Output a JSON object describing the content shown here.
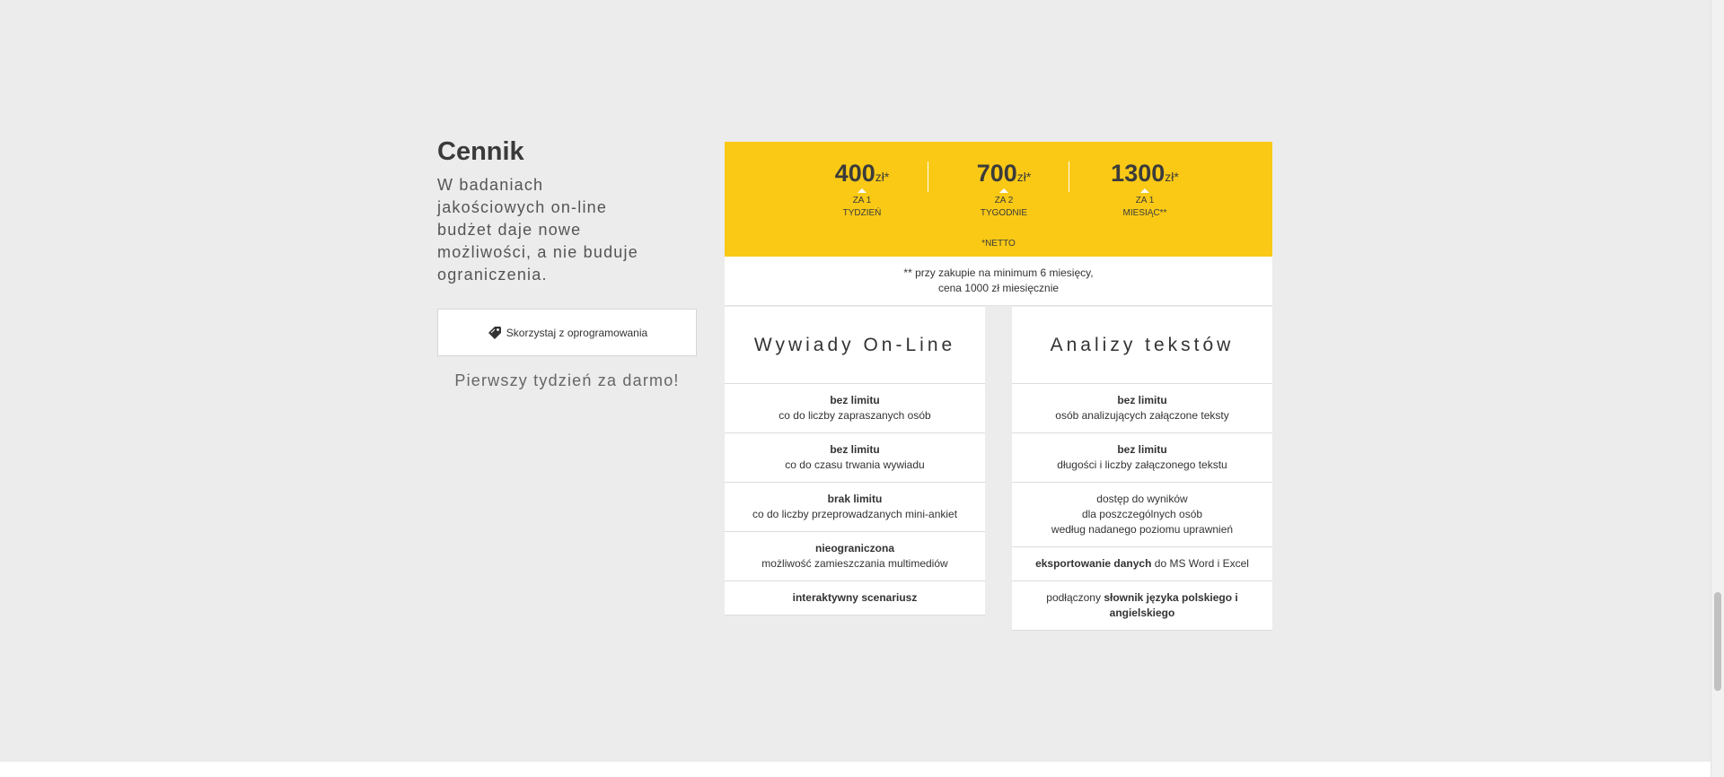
{
  "pricing": {
    "title": "Cennik",
    "description": "W badaniach jakościowych on-line budżet daje nowe możliwości, a nie buduje ograniczenia.",
    "cta_label": "Skorzystaj z oprogramowania",
    "cta_icon": "tag-icon",
    "free_trial": "Pierwszy tydzień za darmo!"
  },
  "prices": [
    {
      "amount": "400",
      "unit": "zł*",
      "period_line1": "ZA 1",
      "period_line2": "TYDZIEŃ"
    },
    {
      "amount": "700",
      "unit": "zł*",
      "period_line1": "ZA 2",
      "period_line2": "TYGODNIE"
    },
    {
      "amount": "1300",
      "unit": "zł*",
      "period_line1": "ZA 1",
      "period_line2": "MIESIĄC**"
    }
  ],
  "netto": "*NETTO",
  "note": {
    "line1": "** przy zakupie na minimum 6 miesięcy,",
    "line2": "cena 1000 zł miesięcznie"
  },
  "columns": [
    {
      "heading": "Wywiady On-Line",
      "rows": [
        {
          "bold": "bez limitu",
          "text": "co do liczby zapraszanych osób"
        },
        {
          "bold": "bez limitu",
          "text": "co do czasu trwania wywiadu"
        },
        {
          "bold": "brak limitu",
          "text": "co do liczby przeprowadzanych mini-ankiet"
        },
        {
          "bold": "nieograniczona",
          "text": "możliwość zamieszczania multimediów"
        },
        {
          "bold": "interaktywny scenariusz",
          "text": ""
        }
      ]
    },
    {
      "heading": "Analizy tekstów",
      "rows": [
        {
          "bold": "bez limitu",
          "text": "osób analizujących załączone teksty"
        },
        {
          "bold": "bez limitu",
          "text": "długości i liczby załączonego tekstu"
        },
        {
          "line1": "dostęp do wyników",
          "line2": "dla poszczególnych osób",
          "line3": "według nadanego poziomu uprawnień"
        },
        {
          "bold": "eksportowanie danych",
          "text": "do MS Word i Excel"
        },
        {
          "prefix": "podłączony",
          "bold": "słownik języka polskiego i angielskiego"
        }
      ]
    }
  ],
  "colors": {
    "accent": "#f9c916",
    "background": "#ececec"
  }
}
